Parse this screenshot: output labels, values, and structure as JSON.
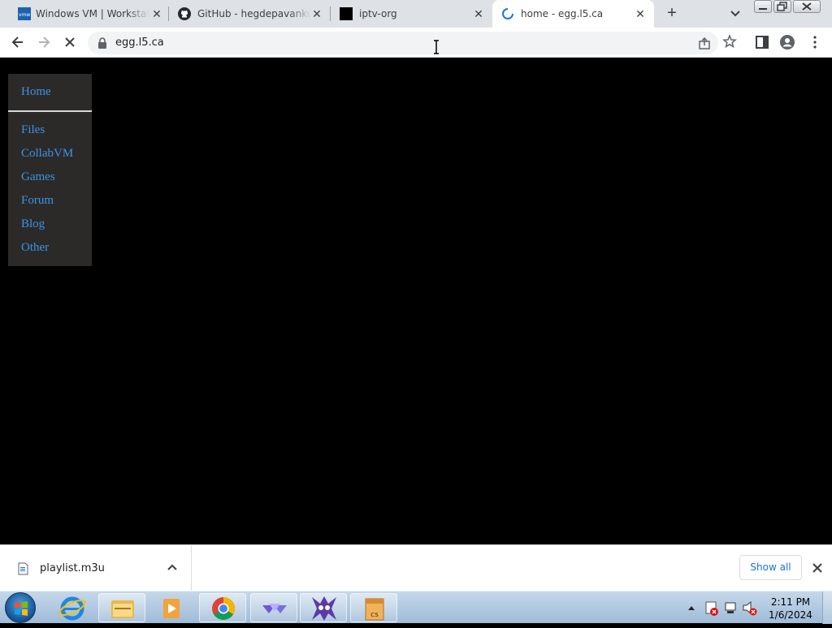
{
  "browser": {
    "tabs": [
      {
        "title": "Windows VM | Workstation",
        "favicon": "vmware-icon",
        "active": false
      },
      {
        "title": "GitHub - hegdepavankumar",
        "favicon": "github-icon",
        "active": false
      },
      {
        "title": "iptv-org",
        "favicon": "iptv-icon",
        "active": false
      },
      {
        "title": "home - egg.l5.ca",
        "favicon": "loading-spinner-icon",
        "active": true
      }
    ],
    "url": "egg.l5.ca",
    "new_tab_symbol": "+",
    "close_symbol": "✕"
  },
  "page": {
    "nav": [
      {
        "label": "Home"
      },
      {
        "label": "Files"
      },
      {
        "label": "CollabVM"
      },
      {
        "label": "Games"
      },
      {
        "label": "Forum"
      },
      {
        "label": "Blog"
      },
      {
        "label": "Other"
      }
    ],
    "link_color": "#3d93e8",
    "background": "#000000",
    "panel_color": "#2b2a28"
  },
  "downloads": {
    "file_name": "playlist.m3u",
    "show_all_label": "Show all"
  },
  "taskbar": {
    "apps": [
      "internet-explorer-icon",
      "file-explorer-icon",
      "media-player-icon",
      "chrome-icon",
      "vm-app-icon",
      "game-app-icon",
      "archive-app-icon"
    ],
    "time": "2:11 PM",
    "date": "1/6/2024"
  }
}
